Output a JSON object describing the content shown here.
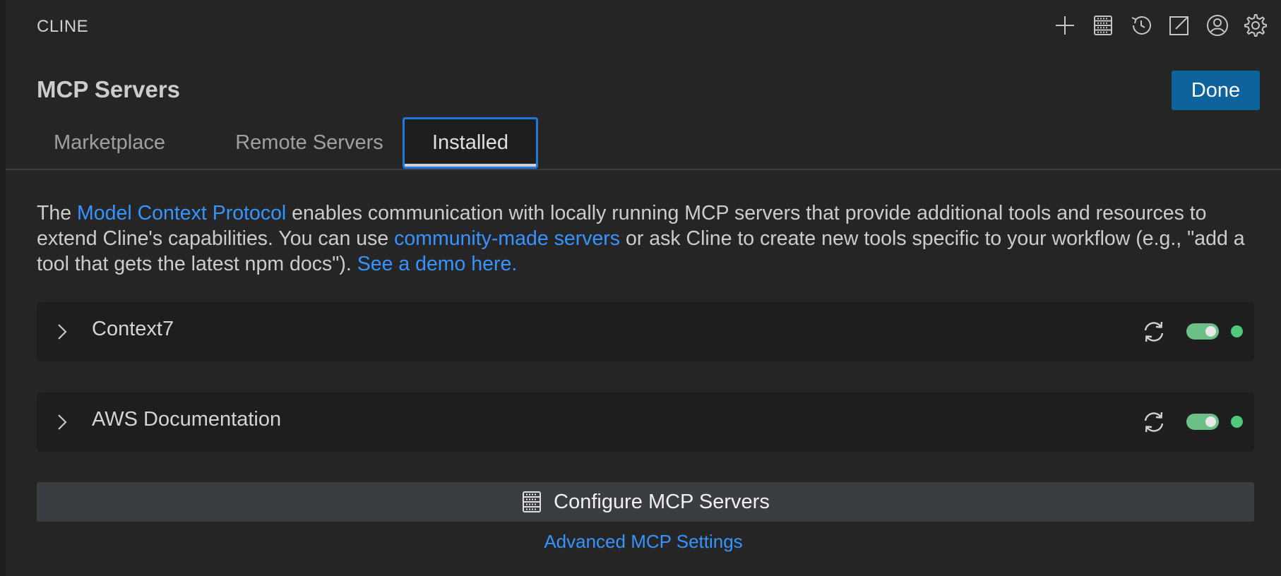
{
  "app": {
    "title": "CLINE"
  },
  "toolbar": {
    "icons": [
      "plus-icon",
      "server-icon",
      "history-icon",
      "popout-icon",
      "account-icon",
      "gear-icon"
    ]
  },
  "header": {
    "title": "MCP Servers",
    "done_label": "Done"
  },
  "tabs": [
    {
      "label": "Marketplace",
      "active": false
    },
    {
      "label": "Remote Servers",
      "active": false
    },
    {
      "label": "Installed",
      "active": true
    }
  ],
  "description": {
    "part1": "The ",
    "link1": "Model Context Protocol",
    "part2": " enables communication with locally running MCP servers that provide additional tools and resources to extend Cline's capabilities. You can use ",
    "link2": "community-made servers",
    "part3": " or ask Cline to create new tools specific to your workflow (e.g., \"add a tool that gets the latest npm docs\"). ",
    "link3": "See a demo here."
  },
  "servers": [
    {
      "name": "Context7",
      "enabled": true,
      "status_color": "#4fc97a"
    },
    {
      "name": "AWS Documentation",
      "enabled": true,
      "status_color": "#4fc97a"
    }
  ],
  "configure": {
    "label": "Configure MCP Servers"
  },
  "advanced": {
    "label": "Advanced MCP Settings"
  },
  "colors": {
    "accent": "#0e639c",
    "link": "#3794ff",
    "toggle_on": "#6bbf87",
    "status_ok": "#4fc97a"
  }
}
